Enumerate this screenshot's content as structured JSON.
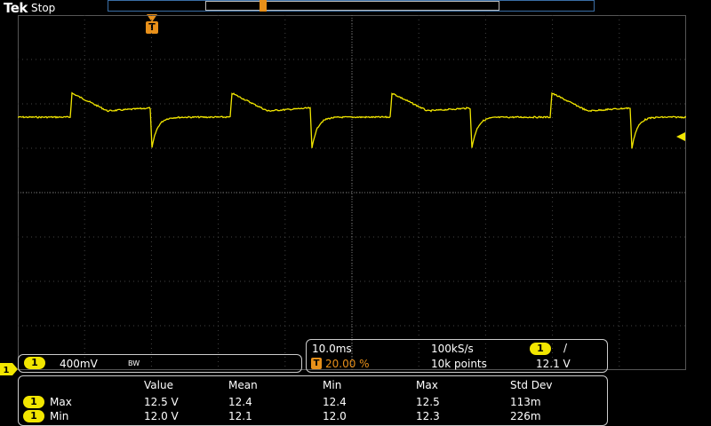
{
  "header": {
    "brand": "Tek",
    "state": "Stop"
  },
  "trigger": {
    "label": "T"
  },
  "channel": {
    "badge": "1",
    "scale": "400mV",
    "bw": "BW",
    "color": "#f2e600"
  },
  "timebase": {
    "time_div": "10.0ms",
    "sample_rate": "100kS/s",
    "trig_position": "20.00 %",
    "record_length": "10k points",
    "trig_source_badge": "1",
    "trig_slope": "/",
    "trig_level": "12.1 V"
  },
  "measurements": {
    "headers": [
      "Value",
      "Mean",
      "Min",
      "Max",
      "Std Dev"
    ],
    "rows": [
      {
        "badge": "1",
        "name": "Max",
        "cells": [
          "12.5 V",
          "12.4",
          "12.4",
          "12.5",
          "113m"
        ]
      },
      {
        "badge": "1",
        "name": "Min",
        "cells": [
          "12.0 V",
          "12.1",
          "12.0",
          "12.3",
          "226m"
        ]
      }
    ]
  },
  "colors": {
    "trigger": "#e8901a",
    "channel": "#f2e600",
    "grid": "#555555"
  }
}
